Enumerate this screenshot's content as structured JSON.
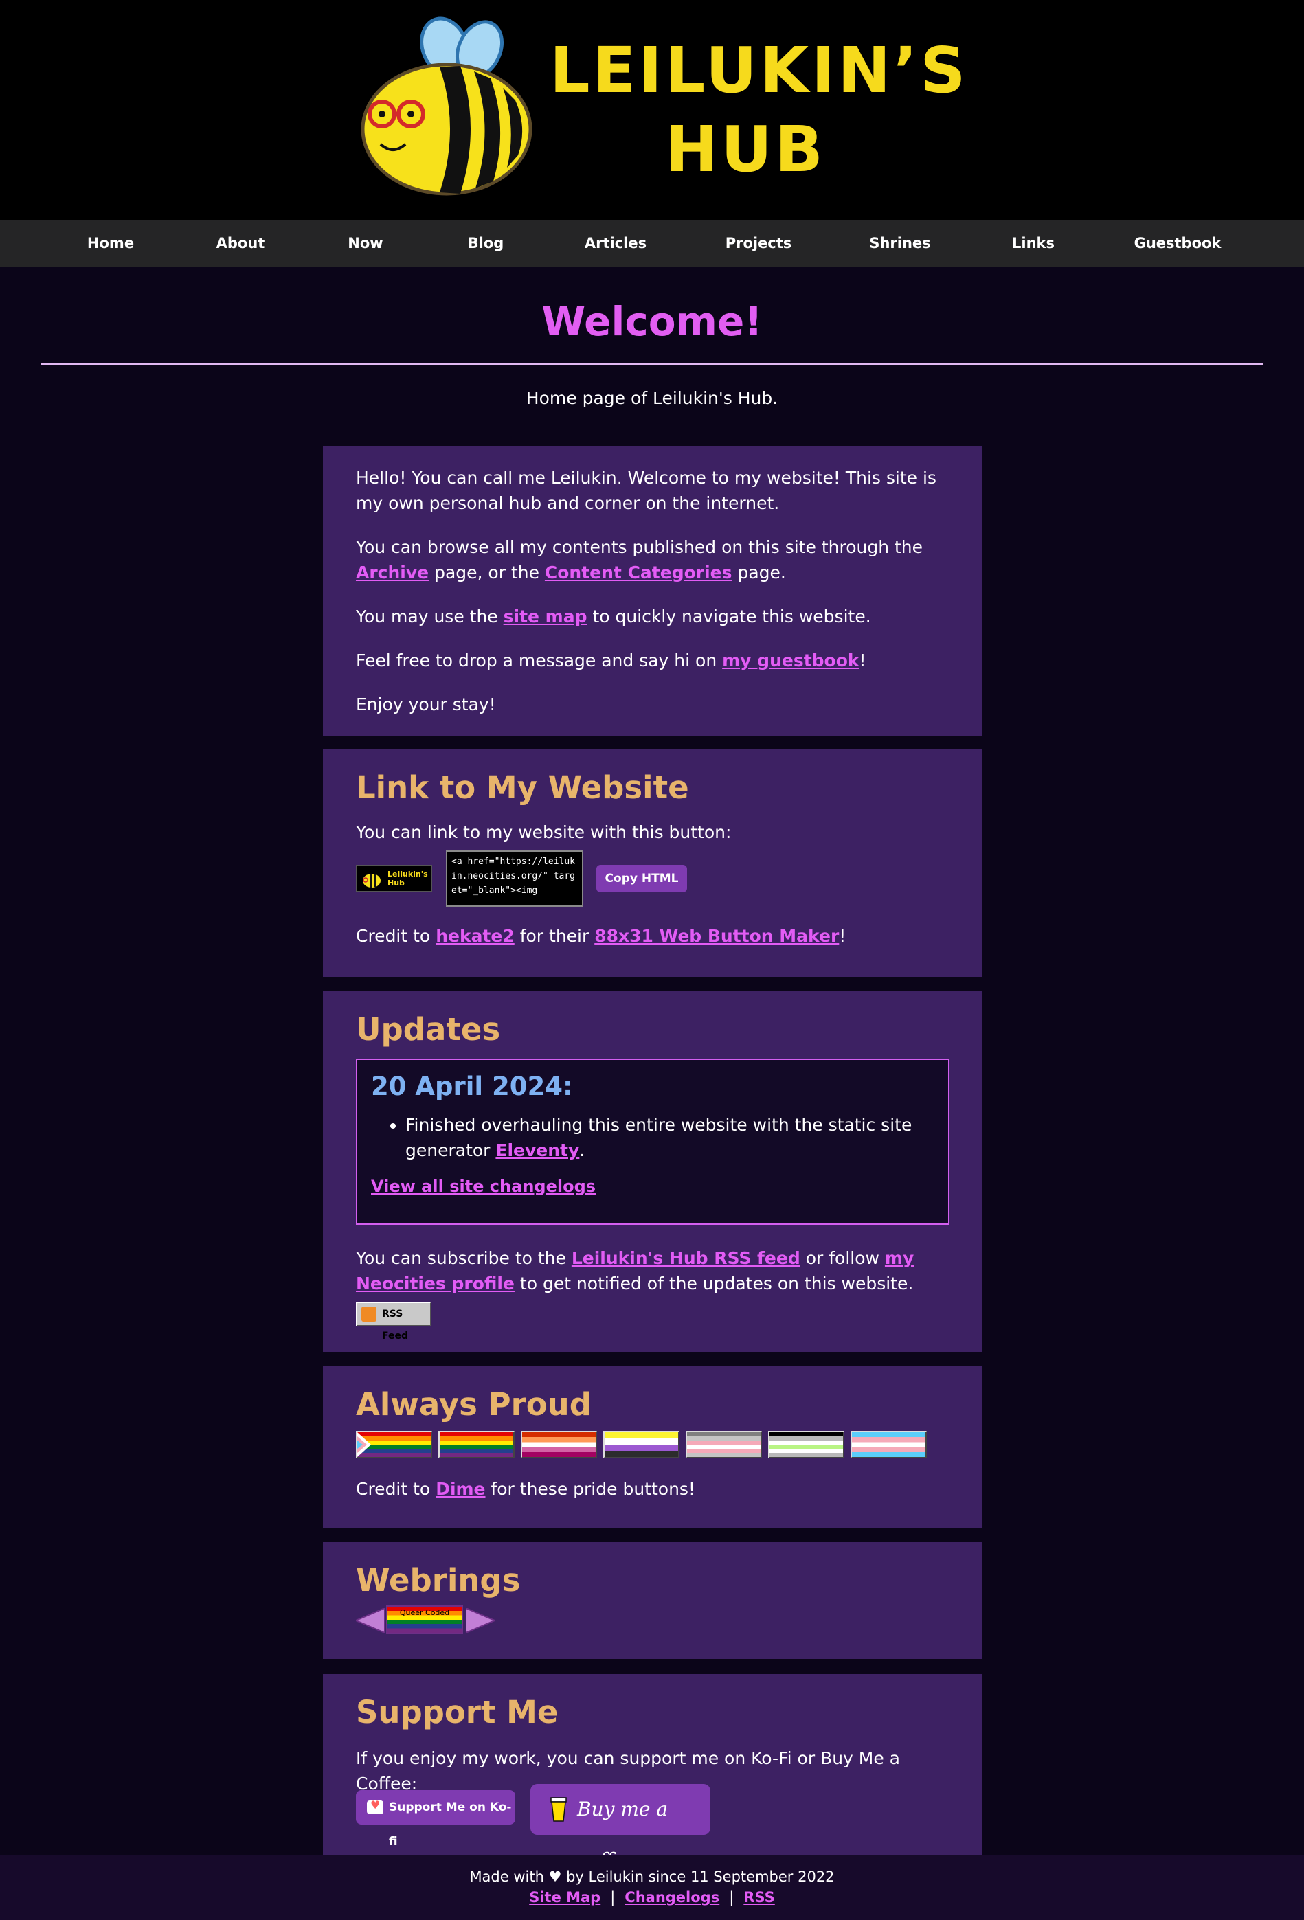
{
  "site": {
    "title_line1": "LEILUKIN’S",
    "title_line2": "HUB"
  },
  "nav": {
    "items": [
      "Home",
      "About",
      "Now",
      "Blog",
      "Articles",
      "Projects",
      "Shrines",
      "Links",
      "Guestbook"
    ]
  },
  "page": {
    "title": "Welcome!",
    "subtitle": "Home page of Leilukin's Hub."
  },
  "intro": {
    "p1": "Hello! You can call me Leilukin. Welcome to my website! This site is my own personal hub and corner on the internet.",
    "p2_before": "You can browse all my contents published on this site through the ",
    "p2_link1": "Archive",
    "p2_middle": " page, or the ",
    "p2_link2": "Content Categories",
    "p2_after": " page.",
    "p3_before": "You may use the ",
    "p3_link": "site map",
    "p3_after": " to quickly navigate this website.",
    "p4_before": "Feel free to drop a message and say hi on ",
    "p4_link": "my guestbook",
    "p4_after": "!",
    "p5": "Enjoy your stay!"
  },
  "link_card": {
    "heading": "Link to My Website",
    "text": "You can link to my website with this button:",
    "badge_text": "Leilukin's Hub",
    "code_value": "<a href=\"https://leilukin.neocities.org/\" target=\"_blank\"><img",
    "copy_label": "Copy HTML",
    "credit_before": "Credit to ",
    "credit_link1": "hekate2",
    "credit_middle": " for their ",
    "credit_link2": "88x31 Web Button Maker",
    "credit_after": "!"
  },
  "updates": {
    "heading": "Updates",
    "date": "20 April 2024:",
    "item_before": "Finished overhauling this entire website with the static site generator ",
    "item_link": "Eleventy",
    "item_after": ".",
    "all_link": "View all site changelogs",
    "sub_before": "You can subscribe to the ",
    "sub_link1": "Leilukin's Hub RSS feed",
    "sub_middle": " or follow ",
    "sub_link2": "my Neocities profile",
    "sub_after": " to get notified of the updates on this website.",
    "rss_badge": "RSS Feed"
  },
  "proud": {
    "heading": "Always Proud",
    "credit_before": "Credit to ",
    "credit_link": "Dime",
    "credit_after": " for these pride buttons!"
  },
  "webrings": {
    "heading": "Webrings",
    "ring_label": "Queer Coded"
  },
  "support": {
    "heading": "Support Me",
    "text": "If you enjoy my work, you can support me on Ko-Fi or Buy Me a Coffee:",
    "kofi_label": "Support Me on Ko-fi",
    "bmc_label": "Buy me a coffee"
  },
  "footer": {
    "made": "Made with ♥ by Leilukin since 11 September 2022",
    "links": [
      "Site Map",
      "Changelogs",
      "RSS"
    ],
    "separator": "|"
  },
  "colors": {
    "background": "#0b0519",
    "card": "#3d2163",
    "heading": "#e8b46b",
    "link": "#e35cf5",
    "title": "#e25ef2",
    "logo": "#f6da1c"
  }
}
